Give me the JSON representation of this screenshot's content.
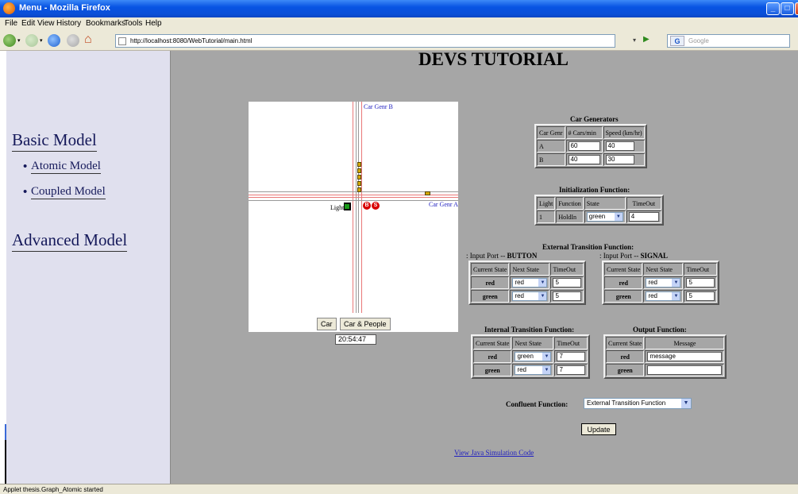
{
  "window": {
    "title": "Menu - Mozilla Firefox"
  },
  "menu": [
    "File",
    "Edit",
    "View",
    "History",
    "Bookmarks",
    "Tools",
    "Help"
  ],
  "address": {
    "url": "http://localhost:8080/WebTutorial/main.html"
  },
  "search": {
    "engine": "G",
    "placeholder": "Google"
  },
  "sidebar": {
    "basic": "Basic Model",
    "atomic": "Atomic Model",
    "coupled": "Coupled Model",
    "advanced": "Advanced Model",
    "bullet": "•"
  },
  "page_title": "DEVS TUTORIAL",
  "applet": {
    "gen_b": "Car Genr B",
    "gen_a": "Car Genr A",
    "light": "Light 1",
    "car_button": "Car",
    "car_people_button": "Car & People",
    "clock": "20:54:47",
    "circle_b": "B",
    "circle_s": "S"
  },
  "car_generators": {
    "heading": "Car Generators",
    "headers": [
      "Car Genr",
      "# Cars/min",
      "Speed (km/hr)"
    ],
    "rows": [
      {
        "genr": "A",
        "cars": "60",
        "speed": "40"
      },
      {
        "genr": "B",
        "cars": "40",
        "speed": "30"
      }
    ]
  },
  "init_function": {
    "heading": "Initialization Function:",
    "headers": [
      "Light",
      "Function",
      "State",
      "TimeOut"
    ],
    "row": {
      "light": "1",
      "function": "HoldIn",
      "state": "green",
      "timeout": "4"
    }
  },
  "external_transition": {
    "heading": "External Transition Function:",
    "port_prefix": ": Input Port -- ",
    "button_port": "BUTTON",
    "signal_port": "SIGNAL",
    "headers": [
      "Current State",
      "Next State",
      "TimeOut"
    ],
    "button_rows": [
      {
        "current": "red",
        "next": "red",
        "timeout": "5"
      },
      {
        "current": "green",
        "next": "red",
        "timeout": "5"
      }
    ],
    "signal_rows": [
      {
        "current": "red",
        "next": "red",
        "timeout": "5"
      },
      {
        "current": "green",
        "next": "red",
        "timeout": "5"
      }
    ]
  },
  "internal_transition": {
    "heading": "Internal Transition Function:",
    "headers": [
      "Current State",
      "Next State",
      "TimeOut"
    ],
    "rows": [
      {
        "current": "red",
        "next": "green",
        "timeout": "7"
      },
      {
        "current": "green",
        "next": "red",
        "timeout": "7"
      }
    ]
  },
  "output_function": {
    "heading": "Output Function:",
    "headers": [
      "Current State",
      "Message"
    ],
    "rows": [
      {
        "current": "red",
        "message": "message"
      },
      {
        "current": "green",
        "message": ""
      }
    ]
  },
  "confluent": {
    "label": "Confluent Function:",
    "value": "External Transition Function"
  },
  "update_button": "Update",
  "view_link": "View Java Simulation Code",
  "status": "Applet thesis.Graph_Atomic started"
}
